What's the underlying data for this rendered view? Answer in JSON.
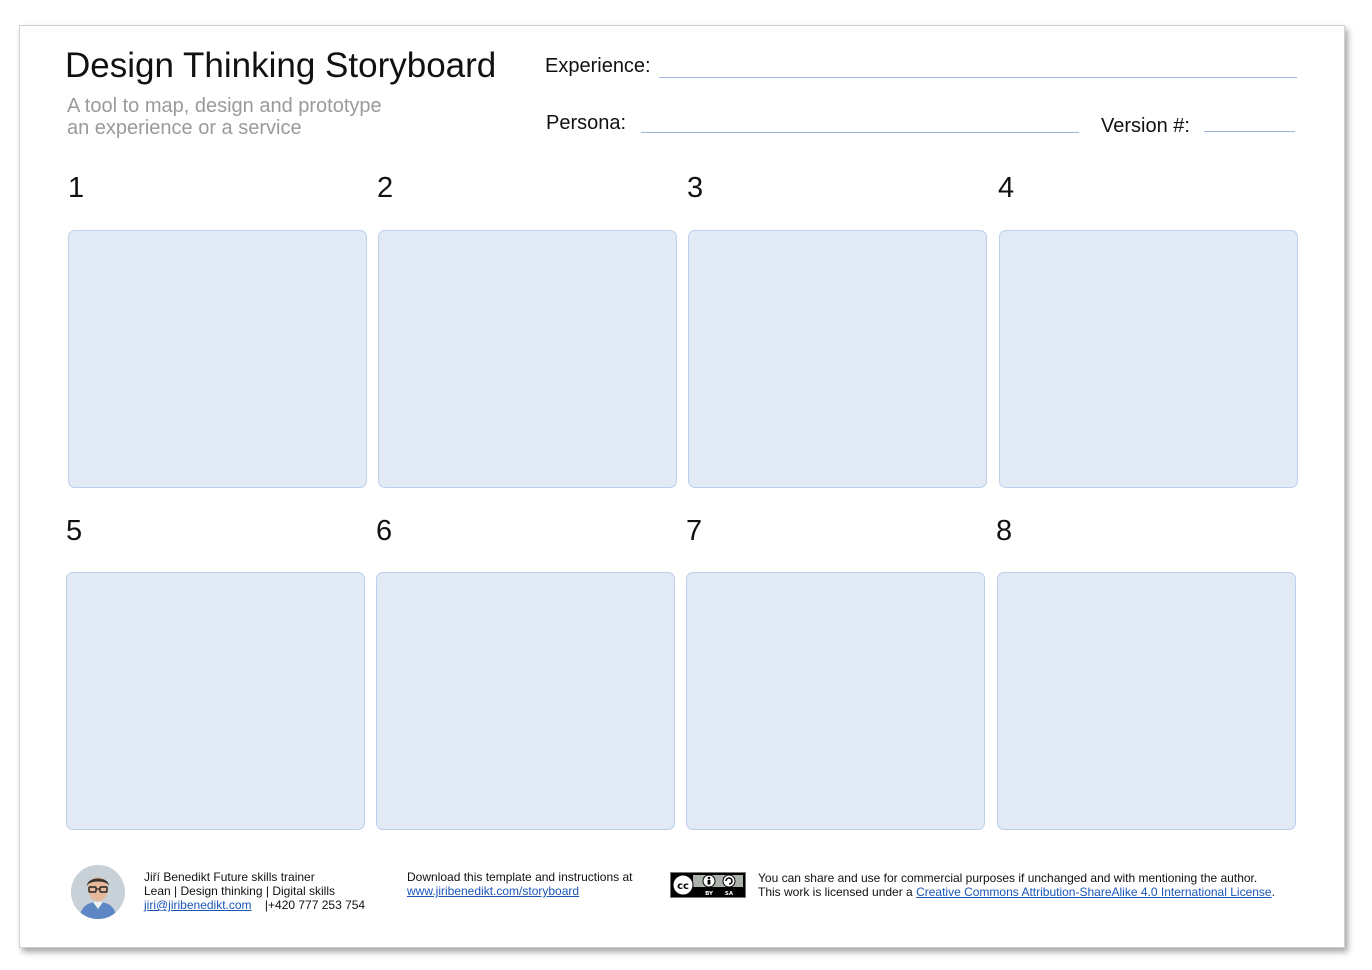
{
  "header": {
    "title": "Design Thinking Storyboard",
    "subtitle_line1": "A tool to map, design and prototype",
    "subtitle_line2": "an experience or a service"
  },
  "fields": {
    "experience_label": "Experience:",
    "persona_label": "Persona:",
    "version_label": "Version #:",
    "line_color": "#9bb4e0"
  },
  "panels": {
    "numbers": [
      "1",
      "2",
      "3",
      "4",
      "5",
      "6",
      "7",
      "8"
    ],
    "fill_color": "#e1eaf5",
    "border_color": "#bcd0ec"
  },
  "footer": {
    "author_line": "Jiří Benedikt Future skills trainer",
    "skills_line": "Lean | Design thinking | Digital skills",
    "email": "jiri@jiribenedikt.com",
    "phone": "|+420 777 253 754",
    "download_text": "Download this template and instructions at",
    "download_link": "www.jiribenedikt.com/storyboard",
    "license_line1": "You can share and use for commercial purposes if unchanged and with mentioning the author.",
    "license_prefix": "This work is licensed under a ",
    "license_link": "Creative Commons Attribution-ShareAlike 4.0 International License",
    "license_suffix": ".",
    "cc_badge": {
      "icons": [
        "cc-icon",
        "by-icon",
        "sa-icon"
      ],
      "labels": [
        "BY",
        "SA"
      ]
    }
  }
}
